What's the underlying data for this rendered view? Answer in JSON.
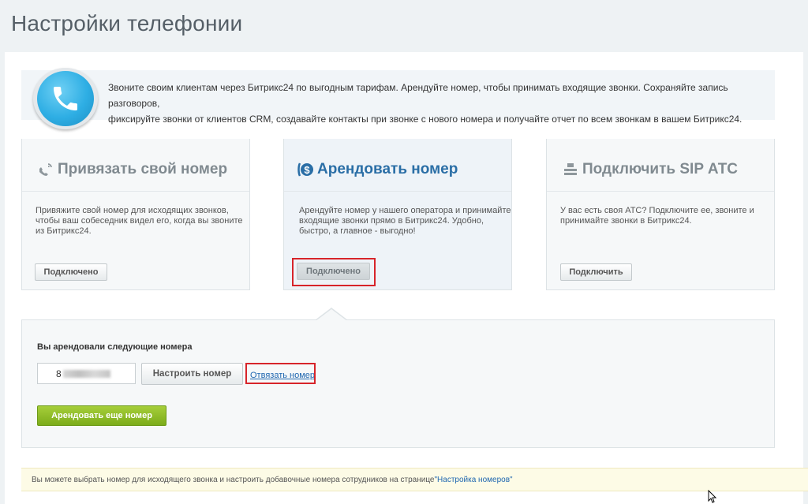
{
  "page_title": "Настройки телефонии",
  "intro": {
    "line1": "Звоните своим клиентам через Битрикс24 по выгодным тарифам. Арендуйте номер, чтобы принимать входящие звонки. Сохраняйте запись разговоров,",
    "line2": "фиксируйте звонки от клиентов CRM, создавайте контакты при звонке с нового номера и получайте отчет по всем звонкам в вашем Битрикс24."
  },
  "cards": [
    {
      "title": "Привязать свой номер",
      "desc": [
        "Привяжите свой номер для исходящих звонков,",
        "чтобы ваш собеседник видел его, когда вы звоните",
        "из Битрикс24."
      ],
      "button": "Подключено",
      "icon": "link-phone-icon"
    },
    {
      "title": "Арендовать номер",
      "desc": [
        "Арендуйте номер у нашего оператора и принимайте",
        "входящие звонки прямо в Битрикс24. Удобно,",
        "быстро, а главное - выгодно!"
      ],
      "button": "Подключено",
      "icon": "dollar-phone-icon"
    },
    {
      "title": "Подключить SIP АТС",
      "desc": [
        "У вас есть своя АТС? Подключите ее, звоните и",
        "принимайте звонки в Битрикс24."
      ],
      "button": "Подключить",
      "icon": "pbx-icon"
    }
  ],
  "rented": {
    "title": "Вы арендовали следующие номера",
    "number_prefix": "8",
    "configure_button": "Настроить номер",
    "unlink_link": "Отвязать номер",
    "rent_more_button": "Арендовать еще номер"
  },
  "notice": {
    "text": "Вы можете выбрать номер для исходящего звонка и настроить добавочные номера сотрудников на странице ",
    "link": "\"Настройка номеров\""
  },
  "colors": {
    "accent_blue": "#2a6ea6",
    "highlight_red": "#d7242a",
    "green_button": "#8bbc24"
  }
}
